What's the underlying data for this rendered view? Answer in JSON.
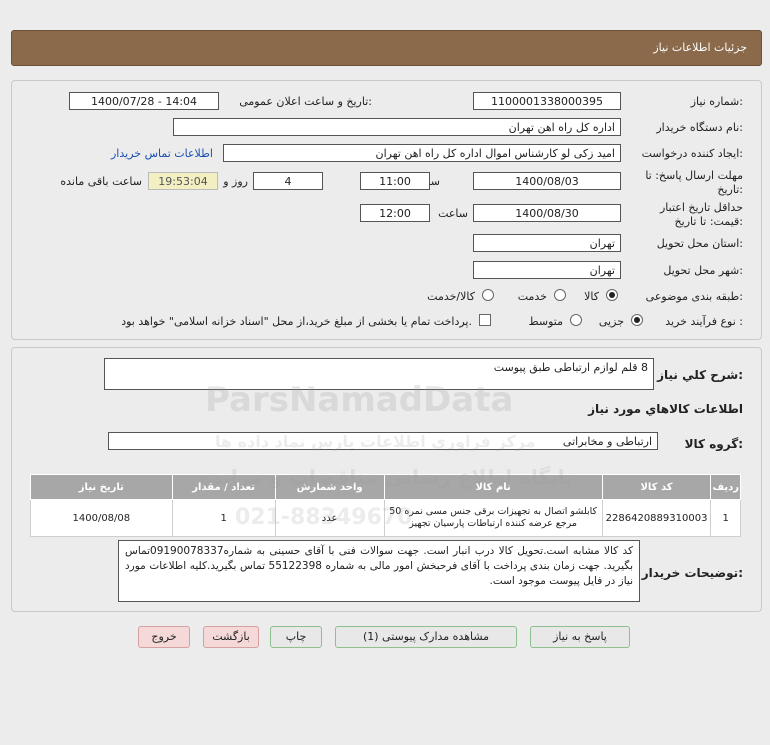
{
  "header": {
    "title": "جزئیات اطلاعات نیاز"
  },
  "form": {
    "need_number_label": "شماره نیاز:",
    "need_number": "1100001338000395",
    "announce_label": "تاریخ و ساعت اعلان عمومی:",
    "announce_value": "1400/07/28 - 14:04",
    "buyer_label": "نام دستگاه خریدار:",
    "buyer_value": "اداره کل راه اهن تهران",
    "creator_label": "ایجاد کننده درخواست:",
    "creator_value": "امید زکی لو کارشناس اموال اداره کل راه اهن تهران",
    "contact_link": "اطلاعات تماس خریدار",
    "deadline_label_1": "مهلت ارسال پاسخ: تا",
    "deadline_label_2": "تاریخ:",
    "deadline_date": "1400/08/03",
    "time_word": "ساعت",
    "deadline_time": "11:00",
    "days_value": "4",
    "days_word": "روز و",
    "remaining_time": "19:53:04",
    "remaining_word": "ساعت باقی مانده",
    "validity_label_1": "حداقل تاریخ اعتبار",
    "validity_label_2": "قیمت: تا تاریخ:",
    "validity_date": "1400/08/30",
    "validity_time": "12:00",
    "province_label": "استان محل تحویل:",
    "province_value": "تهران",
    "city_label": "شهر محل تحویل:",
    "city_value": "تهران",
    "category_label": "طبقه بندی موضوعی:",
    "category_options": [
      "کالا",
      "خدمت",
      "کالا/خدمت"
    ],
    "category_selected": "کالا",
    "process_label": "نوع فرآیند خرید :",
    "process_options": [
      "جزیی",
      "متوسط"
    ],
    "process_selected": "جزیی",
    "payment_note": "پرداخت تمام یا بخشی از مبلغ خرید،از محل \"اسناد خزانه اسلامی\" خواهد بود."
  },
  "details": {
    "summary_label": "شرح کلي نياز:",
    "summary_value": "8 قلم لوازم ارتباطی طبق پیوست",
    "goods_info_title": "اطلاعات کالاهاي مورد نياز",
    "group_label": "گروه کالا:",
    "group_value": "ارتباطی و مخابراتی",
    "table": {
      "headers": [
        "ردیف",
        "کد کالا",
        "نام کالا",
        "واحد شمارش",
        "تعداد / مقدار",
        "تاریخ نیاز"
      ],
      "rows": [
        {
          "row": "1",
          "code": "2286420889310003",
          "name": "کابلشو اتصال به تجهیزات برقی جنس مسی نمره 50 مرجع عرضه کننده ارتباطات پارسیان تجهیز",
          "unit": "عدد",
          "qty": "1",
          "date": "1400/08/08"
        }
      ]
    },
    "buyer_notes_label": "توضیحات خریدار:",
    "buyer_notes": "کد کالا مشابه است.تحویل کالا درب انبار است. جهت سوالات فنی با آقای حسینی به شماره09190078337تماس بگیرید. جهت زمان بندی پرداخت با آقای فرحبخش امور مالی به شماره 55122398 تماس بگیرید.کلیه اطلاعات مورد نیاز در فایل پیوست موجود است."
  },
  "buttons": {
    "reply": "پاسخ به نیاز",
    "attachments": "مشاهده مدارک پیوستی (1)",
    "print": "چاپ",
    "back": "بازگشت",
    "exit": "خروج"
  },
  "watermark": {
    "brand": "ParsNamadData",
    "line1": "پایگاه اطلاع رسانی مناقصات و مزایده",
    "line2": "مرکز فراوری اطلاعات پارس نماد داده ها",
    "phone": "021-88349670"
  },
  "colors": {
    "header_bg": "#8a6a4a",
    "link": "#1a4fb3",
    "table_header": "#a7a7a7",
    "remaining_bg": "#f2efc2"
  }
}
